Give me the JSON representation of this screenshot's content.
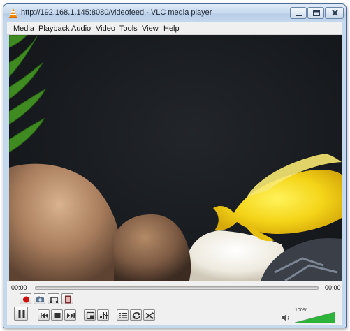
{
  "window": {
    "title": "http://192.168.1.145:8080/videofeed - VLC media player",
    "app_icon": "vlc-cone-icon"
  },
  "menu": {
    "items": [
      {
        "label": "Media"
      },
      {
        "label": "Playback"
      },
      {
        "label": "Audio"
      },
      {
        "label": "Video"
      },
      {
        "label": "Tools"
      },
      {
        "label": "View"
      },
      {
        "label": "Help"
      }
    ]
  },
  "player": {
    "elapsed": "00:00",
    "total": "00:00",
    "volume_label": "100%",
    "volume_level": 1.0
  },
  "controls": {
    "row1": [
      "record-icon",
      "snapshot-icon",
      "loop-ab-icon",
      "frame-step-icon"
    ],
    "row2": [
      "pause-icon",
      "previous-icon",
      "stop-icon",
      "next-icon",
      "fullscreen-icon",
      "extended-settings-icon",
      "playlist-icon",
      "loop-icon",
      "random-icon"
    ]
  },
  "colors": {
    "record": "#cc1111",
    "volume_green": "#2db33a"
  }
}
